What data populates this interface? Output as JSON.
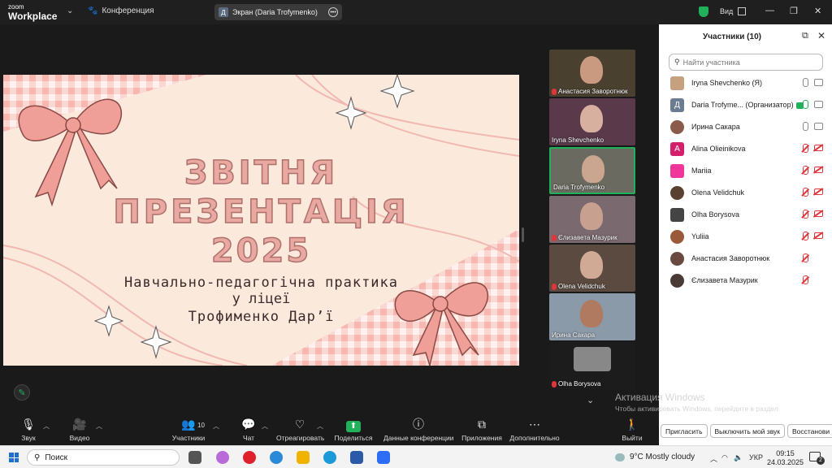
{
  "titlebar": {
    "logo_top": "zoom",
    "logo_bottom": "Workplace",
    "meeting_label": "Конференция",
    "screen_share_avatar": "Д",
    "screen_share_label": "Экран (Daria Trofymenko)",
    "view_label": "Вид"
  },
  "slide": {
    "line1": "ЗВІТНЯ",
    "line2": "ПРЕЗЕНТАЦІЯ",
    "line3": "2025",
    "line4": "Навчально-педагогічна практика",
    "line5": "у ліцеї",
    "line6": "Трофименко Дарʼї",
    "colors": {
      "background": "#fbe9dc",
      "accent": "#e8a9a3",
      "stroke": "#b06f69"
    }
  },
  "thumbnails": [
    {
      "name": "Анастасия Заворотнюк",
      "muted": true
    },
    {
      "name": "Iryna Shevchenko",
      "muted": false
    },
    {
      "name": "Daria Trofymenko",
      "muted": false,
      "active": true
    },
    {
      "name": "Єлизавета Мазурик",
      "muted": true
    },
    {
      "name": "Olena Velidchuk",
      "muted": true
    },
    {
      "name": "Ирина Сакара",
      "muted": false
    },
    {
      "name": "Olha Borysova",
      "muted": true
    }
  ],
  "panel": {
    "title": "Участники (10)",
    "search_placeholder": "Найти участника",
    "participants": [
      {
        "name": "Iryna Shevchenko (Я)",
        "avatar": "",
        "avatar_color": "#c7a080",
        "mic": "on",
        "cam_off": false
      },
      {
        "name": "Daria Trofyme... (Организатор)",
        "avatar": "Д",
        "avatar_color": "#6b7b90",
        "mic": "on",
        "cam_off": false
      },
      {
        "name": "Ирина Сакара",
        "avatar": "",
        "avatar_color": "#8a5a4a",
        "mic": "on",
        "cam_off": false
      },
      {
        "name": "Alina Olieinikova",
        "avatar": "A",
        "avatar_color": "#d4206a",
        "mic": "off",
        "cam_off": true
      },
      {
        "name": "Mariia",
        "avatar": "",
        "avatar_color": "#f0359b",
        "mic": "off",
        "cam_off": true
      },
      {
        "name": "Olena Velidchuk",
        "avatar": "",
        "avatar_color": "#5a4030",
        "mic": "off",
        "cam_off": true
      },
      {
        "name": "Olha Borysova",
        "avatar": "",
        "avatar_color": "#444444",
        "mic": "off",
        "cam_off": true
      },
      {
        "name": "Yuliia",
        "avatar": "",
        "avatar_color": "#9a5a3a",
        "mic": "off",
        "cam_off": true
      },
      {
        "name": "Анастасия Заворотнюк",
        "avatar": "",
        "avatar_color": "#6a4a40",
        "mic": "off",
        "cam_off": true
      },
      {
        "name": "Єлизавета Мазурик",
        "avatar": "",
        "avatar_color": "#4a3a35",
        "mic": "off",
        "cam_off": true
      }
    ],
    "buttons": [
      "Пригласить",
      "Выключить мой звук",
      "Восстанови"
    ]
  },
  "activation": {
    "title": "Активация Windows",
    "subtitle": "Чтобы активировать Windows, перейдите в раздел \"Параметры\"."
  },
  "toolbar": {
    "audio": "Звук",
    "video": "Видео",
    "participants": "Участники",
    "participants_count": "10",
    "chat": "Чат",
    "react": "Отреагировать",
    "share": "Поделиться",
    "meeting_info": "Данные конференции",
    "apps": "Приложения",
    "more": "Дополнительно",
    "leave": "Выйти"
  },
  "taskbar": {
    "search": "Поиск",
    "weather": "9°C  Mostly cloudy",
    "lang": "УКР",
    "time": "09:15",
    "date": "24.03.2025",
    "notifications": "2"
  }
}
